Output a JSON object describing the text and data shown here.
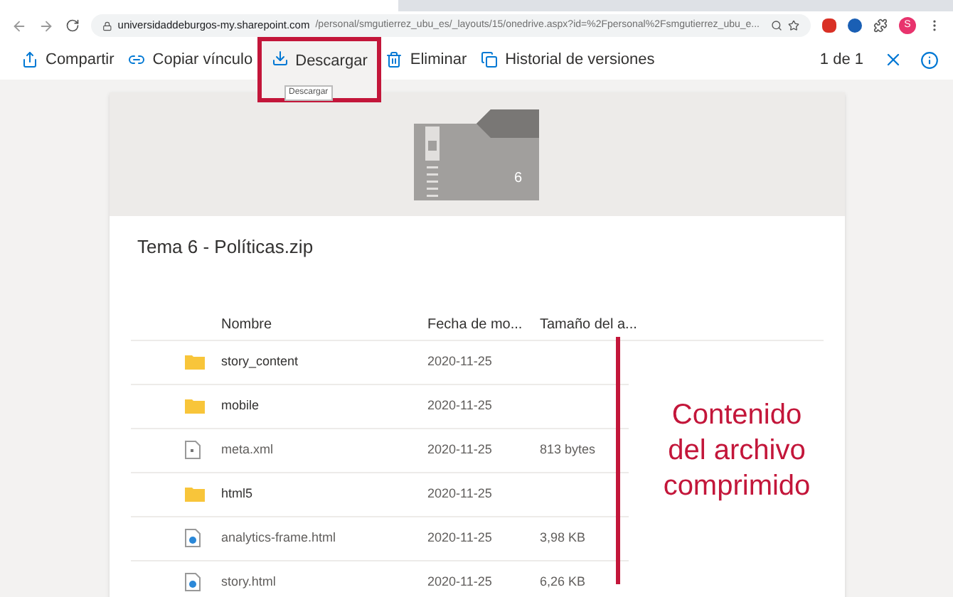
{
  "browser": {
    "url_host": "universidaddeburgos-my.sharepoint.com",
    "url_path": "/personal/smgutierrez_ubu_es/_layouts/15/onedrive.aspx?id=%2Fpersonal%2Fsmgutierrez_ubu_e...",
    "profile_initial": "S"
  },
  "toolbar": {
    "actions": [
      {
        "kind": "share",
        "label": "Compartir",
        "highlighted": false
      },
      {
        "kind": "link",
        "label": "Copiar vínculo",
        "highlighted": false
      },
      {
        "kind": "download",
        "label": "Descargar",
        "highlighted": true
      },
      {
        "kind": "delete",
        "label": "Eliminar",
        "highlighted": false
      },
      {
        "kind": "versions",
        "label": "Historial de versiones",
        "highlighted": false
      }
    ],
    "tooltip": "Descargar",
    "pager": "1 de 1"
  },
  "preview": {
    "badge": "6",
    "title": "Tema 6 - Políticas.zip"
  },
  "table": {
    "columns": [
      "Nombre",
      "Fecha de mo...",
      "Tamaño del a..."
    ],
    "rows": [
      {
        "kind": "folder",
        "name": "story_content",
        "date": "2020-11-25"
      },
      {
        "kind": "folder",
        "name": "mobile",
        "date": "2020-11-25"
      },
      {
        "kind": "file",
        "name": "meta.xml",
        "date": "2020-11-25",
        "size": "813 bytes"
      },
      {
        "kind": "folder",
        "name": "html5",
        "date": "2020-11-25"
      },
      {
        "kind": "web",
        "name": "analytics-frame.html",
        "date": "2020-11-25",
        "size": "3,98 KB"
      },
      {
        "kind": "web",
        "name": "story.html",
        "date": "2020-11-25",
        "size": "6,26 KB"
      }
    ]
  },
  "annotation": {
    "lines": [
      "Contenido",
      "del archivo",
      "comprimido"
    ]
  }
}
